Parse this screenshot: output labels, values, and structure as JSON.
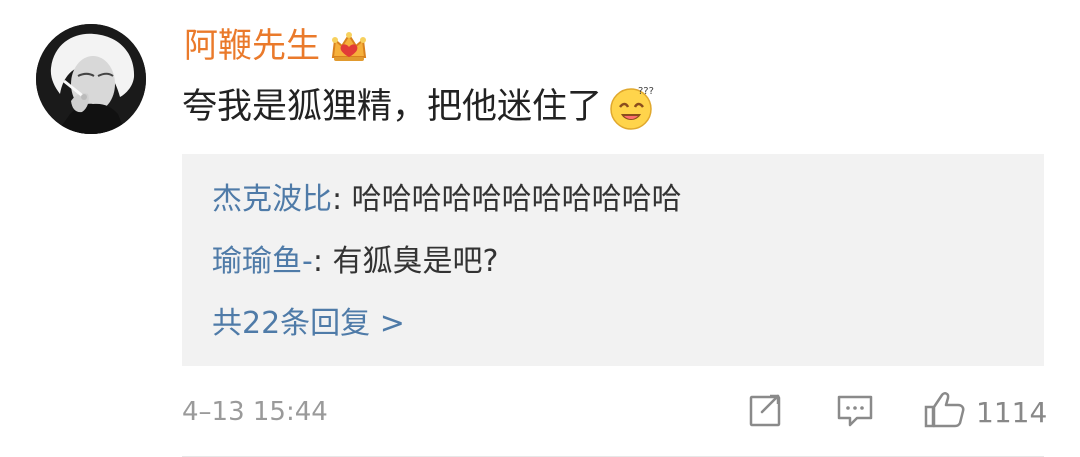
{
  "post": {
    "username": "阿鞭先生",
    "comment_text": "夸我是狐狸精，把他迷住了"
  },
  "replies": [
    {
      "author": "杰克波比",
      "separator": ": ",
      "text": "哈哈哈哈哈哈哈哈哈哈哈"
    },
    {
      "author": "瑜瑜鱼-",
      "separator": ": ",
      "text": "有狐臭是吧?"
    }
  ],
  "replies_more": "共22条回复 >",
  "footer": {
    "date_time": "4–13 15:44",
    "like_count": "1114"
  },
  "icons": {
    "avatar": "avatar",
    "badge": "crown-icon",
    "emoji": "dizzy-smile-emoji",
    "share": "share-icon",
    "comment": "comment-icon",
    "like": "thumbs-up-icon"
  },
  "colors": {
    "username": "#ea7a2b",
    "link": "#4f7ba8",
    "reply_background": "#f2f2f2",
    "text": "#222222",
    "muted": "#9a9a9a"
  }
}
